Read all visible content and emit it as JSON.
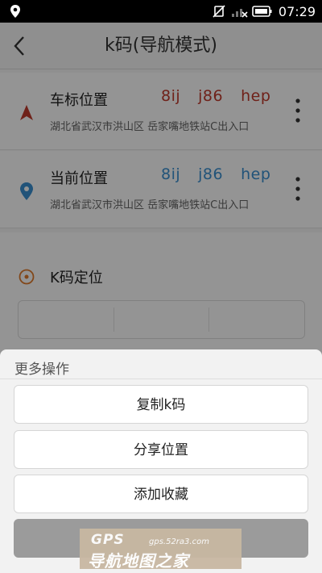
{
  "status_bar": {
    "time": "07:29",
    "icons": [
      "location-icon",
      "vibrate-icon",
      "signal-icon",
      "battery-icon"
    ]
  },
  "header": {
    "title": "k码(导航模式)"
  },
  "locations": [
    {
      "name": "车标位置",
      "code": [
        "8ij",
        "j86",
        "hep"
      ],
      "code_color": "#c0392b",
      "address": "湖北省武汉市洪山区 岳家嘴地铁站C出入口",
      "icon": "car-marker-icon"
    },
    {
      "name": "当前位置",
      "code": [
        "8ij",
        "j86",
        "hep"
      ],
      "code_color": "#3a8fd0",
      "address": "湖北省武汉市洪山区 岳家嘴地铁站C出入口",
      "icon": "location-pin-icon"
    }
  ],
  "k_locate": {
    "label": "K码定位",
    "icon": "target-icon"
  },
  "sheet": {
    "title": "更多操作",
    "buttons": [
      "复制k码",
      "分享位置",
      "添加收藏"
    ]
  },
  "watermark": {
    "line1": "GPS",
    "line2": "gps.52ra3.com",
    "line3": "导航地图之家"
  },
  "colors": {
    "accent_red": "#c0392b",
    "accent_blue": "#3a8fd0",
    "target_orange": "#e07b2b"
  }
}
